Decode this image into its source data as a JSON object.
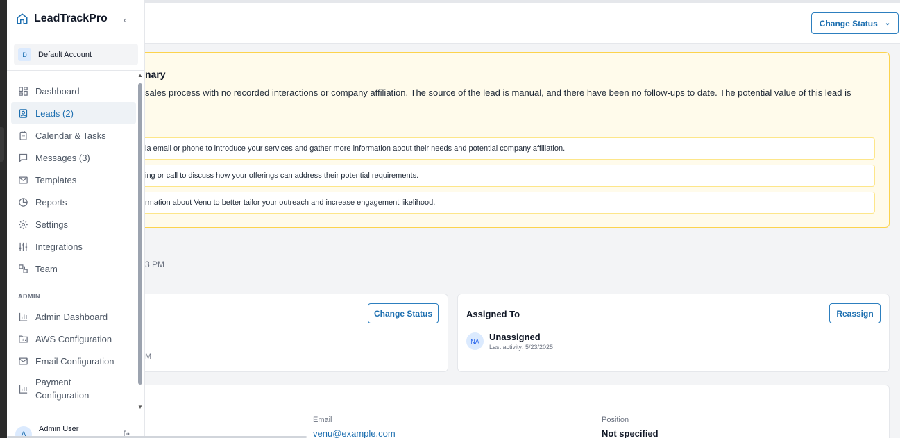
{
  "sidebar": {
    "brand": "LeadTrackPro",
    "account_initial": "D",
    "account_name": "Default Account",
    "nav": [
      {
        "label": "Dashboard",
        "icon": "dashboard-icon",
        "active": false
      },
      {
        "label": "Leads (2)",
        "icon": "leads-icon",
        "active": true
      },
      {
        "label": "Calendar & Tasks",
        "icon": "calendar-icon",
        "active": false
      },
      {
        "label": "Messages (3)",
        "icon": "message-icon",
        "active": false
      },
      {
        "label": "Templates",
        "icon": "mail-icon",
        "active": false
      },
      {
        "label": "Reports",
        "icon": "pie-chart-icon",
        "active": false
      },
      {
        "label": "Settings",
        "icon": "gear-icon",
        "active": false
      },
      {
        "label": "Integrations",
        "icon": "sliders-icon",
        "active": false
      },
      {
        "label": "Team",
        "icon": "team-icon",
        "active": false
      }
    ],
    "admin_section": "ADMIN",
    "admin_nav": [
      {
        "label": "Admin Dashboard",
        "icon": "bar-chart-icon"
      },
      {
        "label": "AWS Configuration",
        "icon": "folder-chart-icon"
      },
      {
        "label": "Email Configuration",
        "icon": "mail-icon"
      },
      {
        "label": "Payment Configuration",
        "icon": "bar-chart-icon"
      }
    ],
    "user_initial": "A",
    "user_name": "Admin User"
  },
  "header": {
    "change_status_label": "Change Status"
  },
  "summary": {
    "title_fragment": "nary",
    "description": "sales process with no recorded interactions or company affiliation. The source of the lead is manual, and there have been no follow-ups to date. The potential value of this lead is",
    "recommendations": [
      "ia email or phone to introduce your services and gather more information about their needs and potential company affiliation.",
      "ing or call to discuss how your offerings can address their potential requirements.",
      "rmation about Venu to better tailor your outreach and increase engagement likelihood."
    ]
  },
  "time_fragment": "3 PM",
  "status_card": {
    "button": "Change Status",
    "time_fragment": "M"
  },
  "assigned_card": {
    "title": "Assigned To",
    "button": "Reassign",
    "avatar": "NA",
    "name": "Unassigned",
    "last_activity": "Last activity: 5/23/2025"
  },
  "info_card": {
    "email_label": "Email",
    "email_value": "venu@example.com",
    "position_label": "Position",
    "position_value": "Not specified"
  },
  "colors": {
    "accent": "#1d6fb0",
    "summary_bg": "#fffbeb",
    "summary_border": "#fcd34d"
  }
}
